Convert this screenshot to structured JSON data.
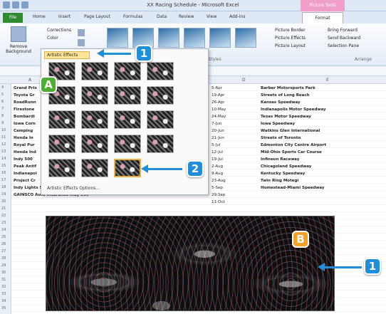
{
  "window": {
    "title": "XX Racing Schedule - Microsoft Excel",
    "context_tab": "Picture Tools"
  },
  "tabs": [
    "File",
    "Home",
    "Insert",
    "Page Layout",
    "Formulas",
    "Data",
    "Review",
    "View",
    "Add-Ins",
    "Format"
  ],
  "ribbon": {
    "remove_background": "Remove Background",
    "corrections": "Corrections",
    "color": "Color",
    "artistic_effects": "Artistic Effects",
    "picture_border": "Picture Border",
    "picture_effects": "Picture Effects",
    "picture_layout": "Picture Layout",
    "bring_forward": "Bring Forward",
    "send_backward": "Send Backward",
    "selection_pane": "Selection Pane",
    "group_styles": "Picture Styles",
    "group_arrange": "Arrange"
  },
  "columns": [
    "A",
    "B",
    "C",
    "D",
    "E"
  ],
  "rows": [
    "4",
    "5",
    "6",
    "7",
    "8",
    "9",
    "10",
    "11",
    "12",
    "13",
    "14",
    "15",
    "16",
    "17",
    "18",
    "19",
    "20",
    "21",
    "22",
    "23",
    "24",
    "25",
    "26",
    "27",
    "28",
    "29",
    "30",
    "31",
    "32",
    "33",
    "34",
    "35"
  ],
  "cells": {
    "col_a": [
      "Grand Prix",
      "Toyota Gr",
      "RoadRunn",
      "Firestone",
      "Bombardi",
      "Iowa Corn",
      "Camping",
      "Honda In",
      "Royal Pur",
      "Honda Ind",
      "Indy 500",
      "Peak Antif",
      "Indianapol",
      "Project Cr",
      "Indy Lights 500",
      "GAINSCO Auto Insurance Indy 300"
    ],
    "col_d": [
      "5-Apr",
      "19-Apr",
      "26-Apr",
      "10-May",
      "24-May",
      "7-Jun",
      "20-Jun",
      "21-Jun",
      "5-Jul",
      "12-Jul",
      "19-Jul",
      "2-Aug",
      "9-Aug",
      "23-Aug",
      "5-Sep",
      "29-Sep",
      "11-Oct"
    ],
    "col_e": [
      "Barber Motorsports Park",
      "Streets of Long Beach",
      "Kansas Speedway",
      "Indianapolis Motor Speedway",
      "Texas Motor Speedway",
      "Iowa Speedway",
      "Watkins Glen International",
      "Streets of Toronto",
      "Edmonton City Centre Airport",
      "Mid-Ohio Sports Car Course",
      "Infineon Raceway",
      "Chicagoland Speedway",
      "Kentucky Speedway",
      "Twin Ring Motegi",
      "Homestead-Miami Speedway"
    ]
  },
  "gallery": {
    "footer": "Artistic Effects Options..."
  },
  "callouts": {
    "A": "A",
    "B": "B",
    "one": "1",
    "two": "2"
  }
}
